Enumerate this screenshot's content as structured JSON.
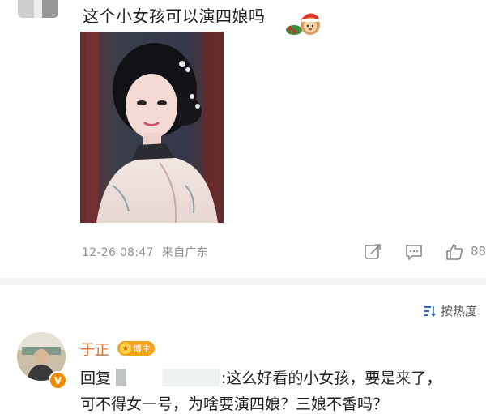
{
  "post": {
    "text": "这个小女孩可以演四娘吗",
    "time": "12-26 08:47",
    "source": "来自广东",
    "like_count": "88"
  },
  "sort": {
    "label": "按热度"
  },
  "comment": {
    "username": "于正",
    "badge": "博主",
    "reply_prefix": "回复",
    "reply_line1": ":这么好看的小女孩，要是来了，",
    "reply_line2": "可不得女一号，为啥要演四娘？三娘不香吗？"
  },
  "colors": {
    "username": "#e06b2a",
    "badge": "#f4a31a",
    "meta": "#8f8f8f"
  }
}
